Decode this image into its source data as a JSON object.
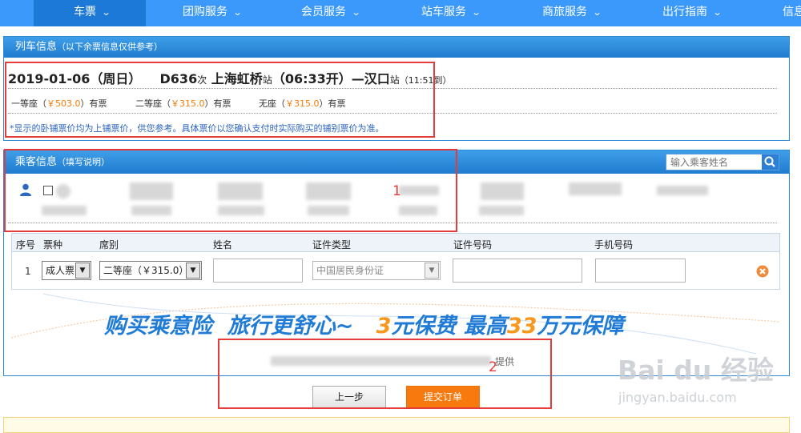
{
  "nav": {
    "items": [
      {
        "label": "车票"
      },
      {
        "label": "团购服务"
      },
      {
        "label": "会员服务"
      },
      {
        "label": "站车服务"
      },
      {
        "label": "商旅服务"
      },
      {
        "label": "出行指南"
      },
      {
        "label": "信息"
      }
    ],
    "chevron": "⌄"
  },
  "train_panel": {
    "title": "列车信息",
    "subtitle": "（以下余票信息仅供参考）",
    "date": "2019-01-06（周日）",
    "train_no": "D636",
    "train_suffix": "次",
    "from_station": "上海虹桥",
    "station_suffix": "站",
    "depart": "（06:33开）",
    "dash": "—",
    "to_station": "汉口",
    "arrive": "（11:51到）",
    "seats": [
      {
        "name": "一等座（",
        "price": "￥503.0",
        "tail": "）有票"
      },
      {
        "name": "二等座（",
        "price": "￥315.0",
        "tail": "）有票"
      },
      {
        "name": "无座（",
        "price": "￥315.0",
        "tail": "）有票"
      }
    ],
    "note": "*显示的卧铺票价均为上铺票价，供您参考。具体票价以您确认支付时实际购买的铺别票价为准。"
  },
  "passenger_panel": {
    "title": "乘客信息",
    "subtitle": "（填写说明）",
    "search_placeholder": "输入乘客姓名",
    "columns": [
      "序号",
      "票种",
      "席别",
      "姓名",
      "证件类型",
      "证件号码",
      "手机号码"
    ],
    "row": {
      "index": "1",
      "ticket_type": "成人票",
      "seat_class": "二等座（￥315.0）",
      "id_type": "中国居民身份证"
    }
  },
  "insurance": {
    "part1": "购买乘意险  旅行更舒心~   ",
    "num1": "3",
    "part2": "元保费  最高",
    "num2": "33",
    "part3": "万元保障",
    "provider_tail": "提供"
  },
  "buttons": {
    "prev": "上一步",
    "submit": "提交订单"
  },
  "annotations": {
    "one": "1",
    "two": "2"
  },
  "watermark": {
    "brand": "Bai du 经验",
    "url": "jingyan.baidu.com"
  },
  "colors": {
    "nav_bg": "#3b99fc",
    "accent_blue": "#2f8ad6",
    "price_orange": "#f77a0a",
    "submit_orange": "#f87a0e",
    "annotation_red": "#e53b3b"
  }
}
